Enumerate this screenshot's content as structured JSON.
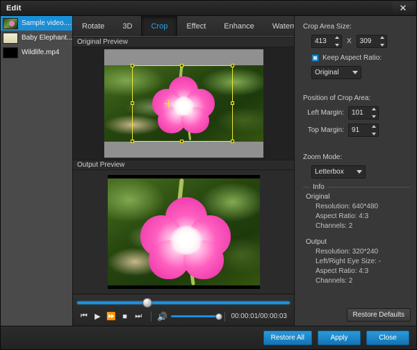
{
  "window": {
    "title": "Edit",
    "close_icon": "close-icon"
  },
  "sidebar": {
    "items": [
      {
        "label": "Sample video....",
        "selected": true
      },
      {
        "label": "Baby Elephant...",
        "selected": false
      },
      {
        "label": "Wildlife.mp4",
        "selected": false
      }
    ]
  },
  "tabs": [
    {
      "label": "Rotate",
      "active": false
    },
    {
      "label": "3D",
      "active": false
    },
    {
      "label": "Crop",
      "active": true
    },
    {
      "label": "Effect",
      "active": false
    },
    {
      "label": "Enhance",
      "active": false
    },
    {
      "label": "Watermark",
      "active": false
    }
  ],
  "preview": {
    "original_label": "Original Preview",
    "output_label": "Output Preview"
  },
  "crop_panel": {
    "size_label": "Crop Area Size:",
    "width_value": "413",
    "height_value": "309",
    "x_separator": "X",
    "keep_aspect_label": "Keep Aspect Ratio:",
    "keep_aspect_checked": true,
    "aspect_value": "Original",
    "position_label": "Position of Crop Area:",
    "left_margin_label": "Left Margin:",
    "left_margin_value": "101",
    "top_margin_label": "Top Margin:",
    "top_margin_value": "91",
    "zoom_mode_label": "Zoom Mode:",
    "zoom_mode_value": "Letterbox"
  },
  "info": {
    "title": "Info",
    "original_heading": "Original",
    "original_lines": [
      "Resolution: 640*480",
      "Aspect Ratio: 4:3",
      "Channels: 2"
    ],
    "output_heading": "Output",
    "output_lines": [
      "Resolution: 320*240",
      "Left/Right Eye Size: -",
      "Aspect Ratio: 4:3",
      "Channels: 2"
    ],
    "restore_defaults_label": "Restore Defaults"
  },
  "transport": {
    "prev_icon": "skip-previous-icon",
    "play_icon": "play-icon",
    "forward_icon": "fast-forward-icon",
    "stop_icon": "stop-icon",
    "next_icon": "skip-next-icon",
    "volume_icon": "volume-icon",
    "timecode": "00:00:01/00:00:03",
    "scrub_percent": 33,
    "volume_percent": 100
  },
  "footer": {
    "restore_all": "Restore All",
    "apply": "Apply",
    "close": "Close"
  },
  "colors": {
    "accent": "#1d8fe0",
    "crop_outline": "#f2ea36",
    "selected_row": "#1a8fd6",
    "panel_bg": "#383838"
  }
}
